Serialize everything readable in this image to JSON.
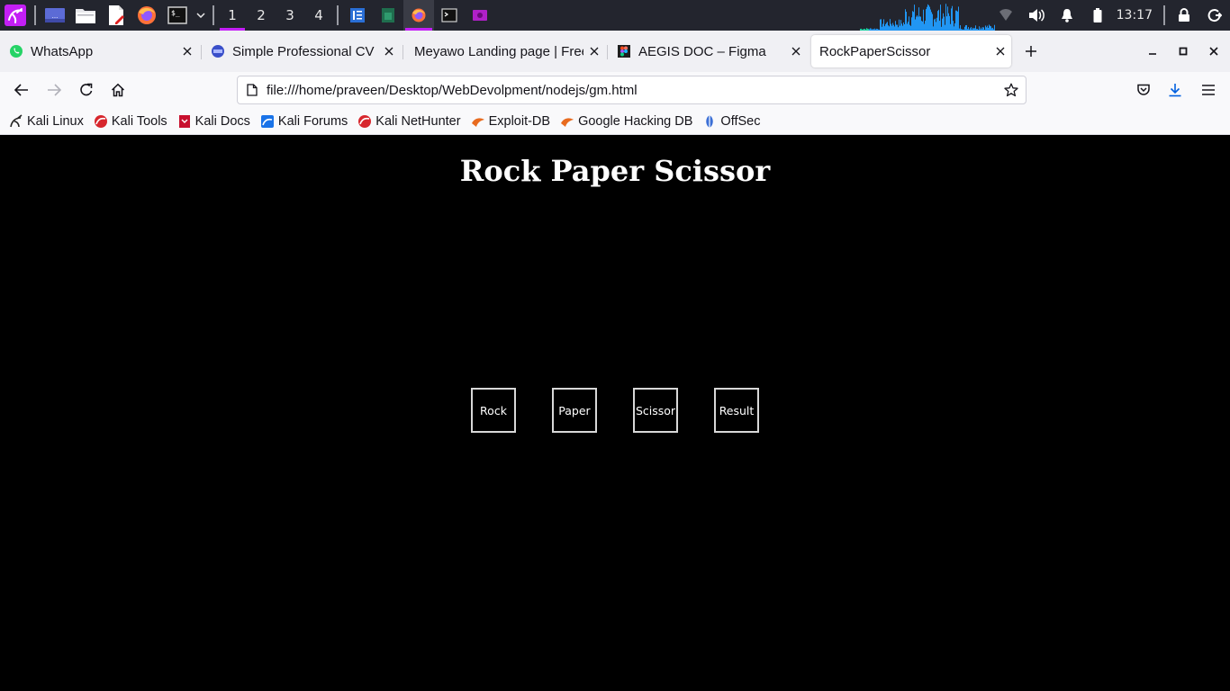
{
  "panel": {
    "workspaces": [
      "1",
      "2",
      "3",
      "4"
    ],
    "active_workspace": "1",
    "clock": "13:17",
    "accent_color": "#c31ff5",
    "launchers": [
      "kali-menu-icon",
      "show-desktop-icon",
      "file-manager-icon",
      "text-editor-icon",
      "firefox-icon",
      "terminal-icon"
    ],
    "tasks": [
      "text-editor-task-icon",
      "document-task-icon",
      "firefox-task-icon",
      "terminal-task-icon",
      "screenshot-task-icon"
    ]
  },
  "tabs": [
    {
      "title": "WhatsApp",
      "icon": "whatsapp-icon"
    },
    {
      "title": "Simple Professional CV Re",
      "icon": "cv-site-icon"
    },
    {
      "title": "Meyawo Landing page | Free",
      "icon": "none"
    },
    {
      "title": "AEGIS DOC – Figma",
      "icon": "figma-icon"
    },
    {
      "title": "RockPaperScissor",
      "icon": "none",
      "selected": true
    }
  ],
  "nav": {
    "url": "file:///home/praveen/Desktop/WebDevolpment/nodejs/gm.html"
  },
  "bookmarks": [
    {
      "label": "Kali Linux",
      "icon": "kali-icon"
    },
    {
      "label": "Kali Tools",
      "icon": "kali-tools-icon"
    },
    {
      "label": "Kali Docs",
      "icon": "kali-docs-icon"
    },
    {
      "label": "Kali Forums",
      "icon": "kali-forums-icon"
    },
    {
      "label": "Kali NetHunter",
      "icon": "nethunter-icon"
    },
    {
      "label": "Exploit-DB",
      "icon": "exploit-db-icon"
    },
    {
      "label": "Google Hacking DB",
      "icon": "ghdb-icon"
    },
    {
      "label": "OffSec",
      "icon": "offsec-icon"
    }
  ],
  "page": {
    "title": "Rock Paper Scissor",
    "buttons": {
      "rock": "Rock",
      "paper": "Paper",
      "scissor": "Scissor",
      "result": "Result"
    }
  }
}
